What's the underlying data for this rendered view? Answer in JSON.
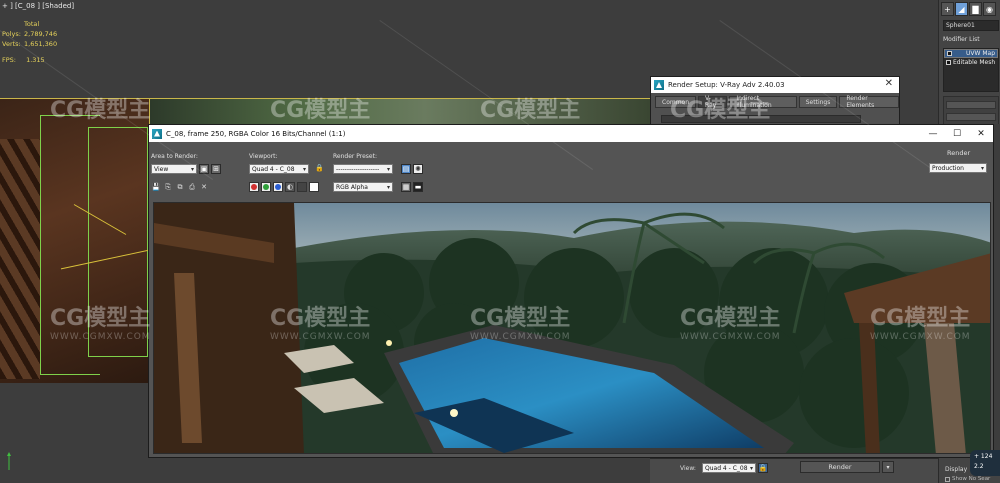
{
  "viewport": {
    "label": "+ ] [C_08 ] [Shaded]",
    "stats": [
      {
        "key": "",
        "value": "Total"
      },
      {
        "key": "Polys:",
        "value": "2,789,746"
      },
      {
        "key": "Verts:",
        "value": "1,651,360"
      }
    ],
    "fps_label": "FPS:",
    "fps_value": "1.315"
  },
  "command_panel": {
    "tabs": [
      "+",
      "◢",
      "▇",
      "◉"
    ],
    "object_name": "Sphere01",
    "modifier_list_label": "Modifier List",
    "stack": [
      {
        "label": "UVW Map",
        "selected": true
      },
      {
        "label": "Editable Mesh",
        "selected": false
      }
    ],
    "display_label": "Display",
    "show_label": "Show No Sear"
  },
  "render_setup": {
    "title": "Render Setup: V-Ray Adv 2.40.03",
    "close": "✕",
    "tabs": [
      "Common",
      "V-Ray",
      "Indirect illumination",
      "Settings",
      "Render Elements"
    ]
  },
  "frame_buffer": {
    "title": "C_08, frame 250, RGBA Color 16 Bits/Channel (1:1)",
    "controls": {
      "minimize": "—",
      "maximize": "☐",
      "close": "✕"
    },
    "area_to_render_label": "Area to Render:",
    "area_to_render_value": "View",
    "viewport_label": "Viewport:",
    "viewport_value": "Quad 4 - C_08",
    "render_preset_label": "Render Preset:",
    "render_preset_value": "--------------------",
    "render_label": "Render",
    "render_mode_value": "Production",
    "channel_value": "RGB Alpha",
    "channel_colors": [
      "#d23030",
      "#2fa03a",
      "#2a5ed4"
    ]
  },
  "bottom_bar": {
    "view_label": "View:",
    "view_value": "Quad 4 - C_08",
    "render_button": "Render"
  },
  "nav": {
    "line1": "+ 124",
    "line2": "2.2"
  },
  "watermark": {
    "brand": "CG模型主",
    "url": "WWW.CGMXW.COM"
  }
}
